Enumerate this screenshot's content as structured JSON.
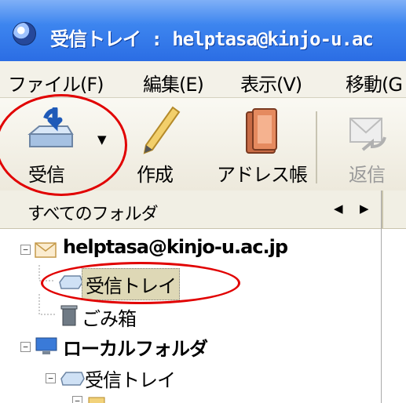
{
  "window": {
    "title": "受信トレイ : helptasa@kinjo-u.ac"
  },
  "menu": [
    "ファイル(F)",
    "編集(E)",
    "表示(V)",
    "移動(G"
  ],
  "toolbar": {
    "receive": "受信",
    "compose": "作成",
    "addressbook": "アドレス帳",
    "reply": "返信"
  },
  "sidebar": {
    "header": "すべてのフォルダ",
    "tree": {
      "account": "helptasa@kinjo-u.ac.jp",
      "inbox": "受信トレイ",
      "trash": "ごみ箱",
      "local": "ローカルフォルダ",
      "local_inbox": "受信トレイ"
    }
  },
  "colors": {
    "accent": "#2b6de4",
    "highlight": "#e10000",
    "selected": "#ded8b6"
  }
}
